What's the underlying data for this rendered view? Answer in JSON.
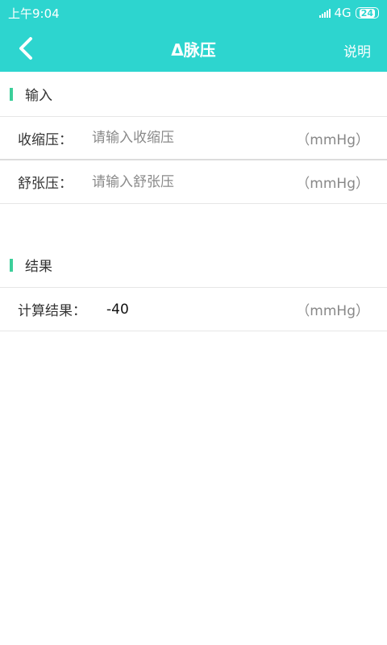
{
  "status": {
    "time": "上午9:04",
    "network": "4G",
    "battery": "24"
  },
  "header": {
    "title": "Δ脉压",
    "help_label": "说明"
  },
  "sections": {
    "input": {
      "title": "输入"
    },
    "result": {
      "title": "结果"
    }
  },
  "fields": {
    "systolic": {
      "label": "收缩压：",
      "placeholder": "请输入收缩压",
      "unit": "（mmHg）"
    },
    "diastolic": {
      "label": "舒张压：",
      "placeholder": "请输入舒张压",
      "unit": "（mmHg）"
    }
  },
  "result": {
    "label": "计算结果：",
    "value": "-40",
    "unit": "（mmHg）"
  },
  "colors": {
    "accent": "#2dd5cf",
    "marker": "#3ccf9a"
  }
}
